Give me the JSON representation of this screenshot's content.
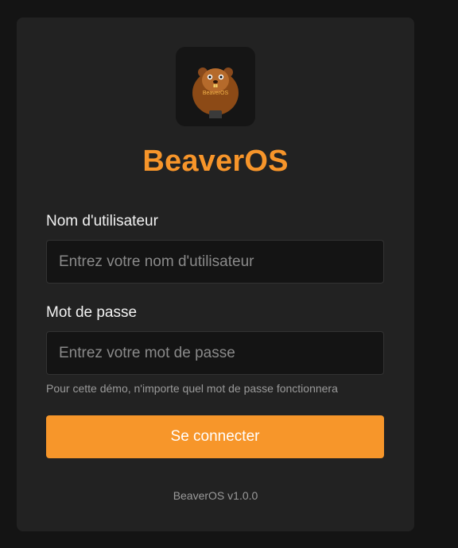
{
  "app": {
    "name": "BeaverOS",
    "version_text": "BeaverOS v1.0.0",
    "accent_color": "#f7962a",
    "logo_icon": "beaver-icon",
    "logo_text": "BeaverOS"
  },
  "form": {
    "username_label": "Nom d'utilisateur",
    "username_placeholder": "Entrez votre nom d'utilisateur",
    "username_value": "",
    "password_label": "Mot de passe",
    "password_placeholder": "Entrez votre mot de passe",
    "password_value": "",
    "hint": "Pour cette démo, n'importe quel mot de passe fonctionnera",
    "submit_label": "Se connecter"
  }
}
